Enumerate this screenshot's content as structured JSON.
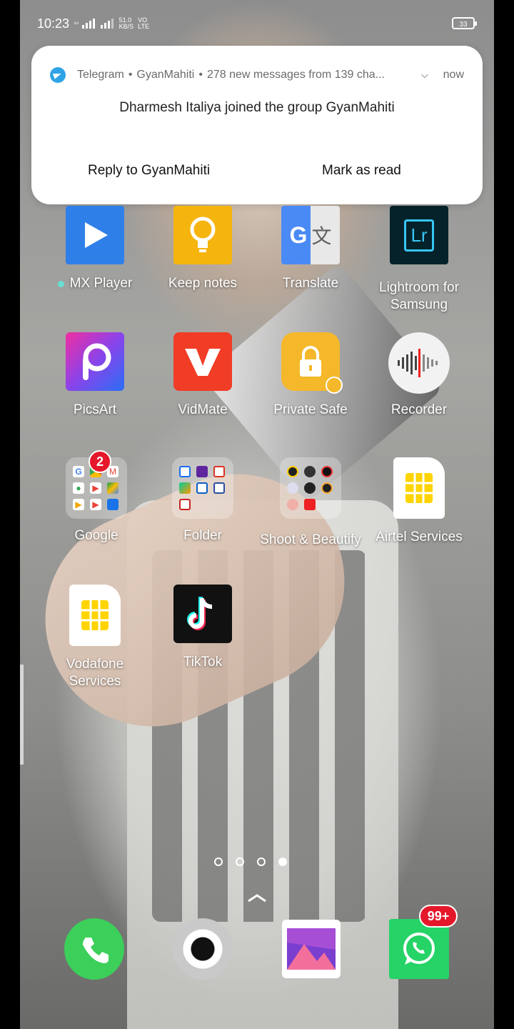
{
  "status_bar": {
    "time": "10:23",
    "network_top": "⁴⁶",
    "net_speed": "51.0",
    "net_unit": "KB/S",
    "volte": "VO LTE",
    "battery": "33"
  },
  "notification": {
    "app": "Telegram",
    "group": "GyanMahiti",
    "summary": "278 new messages from 139 cha...",
    "time": "now",
    "message": "Dharmesh Italiya joined the group GyanMahiti",
    "action_reply": "Reply to GyanMahiti",
    "action_mark": "Mark as read",
    "separator": "•"
  },
  "apps": [
    {
      "label": "MX Player",
      "icon": "play-icon",
      "color": "#2f7fe8"
    },
    {
      "label": "Keep notes",
      "icon": "lightbulb-icon",
      "color": "#f6b40f"
    },
    {
      "label": "Translate",
      "icon": "translate-icon",
      "color": "#4a8af4"
    },
    {
      "label": "Lightroom for Samsung",
      "icon": "lightroom-icon",
      "color": "#05222a",
      "icon_text": "Lr"
    },
    {
      "label": "PicsArt",
      "icon": "picsart-icon",
      "color": "#c43ee0"
    },
    {
      "label": "VidMate",
      "icon": "vidmate-icon",
      "color": "#f13c26"
    },
    {
      "label": "Private Safe",
      "icon": "lock-icon",
      "color": "#f5b82b"
    },
    {
      "label": "Recorder",
      "icon": "waveform-icon",
      "color": "#f2f2f2"
    },
    {
      "label": "Google",
      "icon": "folder-icon",
      "badge": "2"
    },
    {
      "label": "Folder",
      "icon": "folder-icon"
    },
    {
      "label": "Shoot & Beautify",
      "icon": "folder-icon"
    },
    {
      "label": "Airtel Services",
      "icon": "sim-card-icon"
    },
    {
      "label": "Vodafone Services",
      "icon": "sim-card-icon"
    },
    {
      "label": "TikTok",
      "icon": "tiktok-icon",
      "color": "#111111"
    }
  ],
  "page_indicator": {
    "pages": 4,
    "current": 4
  },
  "dock": [
    {
      "name": "phone",
      "icon": "phone-icon",
      "color": "#3ccf5a"
    },
    {
      "name": "camera",
      "icon": "camera-icon",
      "color": "#e9e9e9"
    },
    {
      "name": "gallery",
      "icon": "gallery-icon",
      "color": "#8d4ad6"
    },
    {
      "name": "whatsapp",
      "icon": "whatsapp-icon",
      "color": "#25d366",
      "badge": "99+"
    }
  ]
}
